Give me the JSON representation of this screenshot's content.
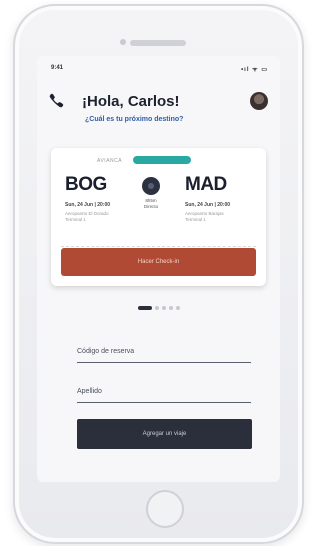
{
  "status_bar": {
    "time": "9:41",
    "icons": "•ıl ᯤ ▭"
  },
  "header": {
    "greeting": "¡Hola, Carlos!",
    "subtitle": "¿Cuál es tu próximo destino?"
  },
  "flight_card": {
    "tag_label": "AVIANCA",
    "origin": {
      "code": "BOG",
      "date": "Sun, 24 Jun | 20:00",
      "airport": "Aeropuerto El Dorado Terminal 1"
    },
    "duration": {
      "value": "8h5m",
      "type": "Directo"
    },
    "destination": {
      "code": "MAD",
      "date": "Sun, 24 Jun | 20:00",
      "airport": "Aeropuerto Barajas Terminal 1"
    },
    "checkin_label": "Hacer Check-in"
  },
  "pagination": {
    "total": 5,
    "active_index": 0
  },
  "form": {
    "reservation_label": "Código de reserva",
    "surname_label": "Apellido",
    "submit_label": "Agregar un viaje"
  },
  "colors": {
    "accent_teal": "#2aa8a2",
    "checkin_button": "#b14a35",
    "submit_button": "#2b2e3b",
    "subtitle_blue": "#2f5fa4"
  }
}
